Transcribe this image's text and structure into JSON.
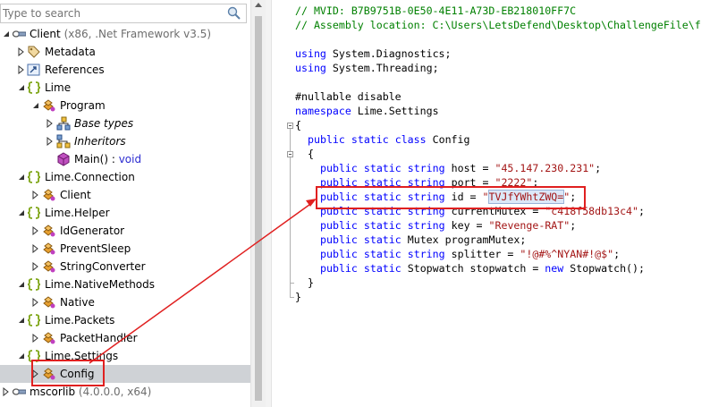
{
  "search": {
    "placeholder": "Type to search"
  },
  "tree": {
    "client": {
      "name": "Client",
      "details": " (x86, .Net Framework v3.5)"
    },
    "metadata": "Metadata",
    "references": "References",
    "lime": "Lime",
    "program": "Program",
    "base_types": "Base types",
    "inheritors": "Inheritors",
    "main_method": {
      "name": "Main()",
      "sep": " : ",
      "type": "void"
    },
    "lime_connection": "Lime.Connection",
    "client_class": "Client",
    "lime_helper": "Lime.Helper",
    "id_generator": "IdGenerator",
    "prevent_sleep": "PreventSleep",
    "string_converter": "StringConverter",
    "lime_native": "Lime.NativeMethods",
    "native": "Native",
    "lime_packets": "Lime.Packets",
    "packet_handler": "PacketHandler",
    "lime_settings": "Lime.Settings",
    "config": "Config",
    "mscorlib": {
      "name": "mscorlib",
      "details": " (4.0.0.0, x64)"
    }
  },
  "code": {
    "mvid": "// MVID: B7B9751B-0E50-4E11-A73D-EB218010FF7C",
    "location": "// Assembly location: C:\\Users\\LetsDefend\\Desktop\\ChallengeFile\\f",
    "kw_using": "using",
    "using_diag": " System.Diagnostics;",
    "using_thread": " System.Threading;",
    "nullable": "#nullable disable",
    "kw_namespace": "namespace",
    "namespace_name": " Lime.Settings",
    "open_brace": "{",
    "close_brace": "}",
    "kw_public_static_class": "public static class",
    "class_name": " Config",
    "kw_public_static": "public static",
    "kw_string": "string",
    "kw_new": "new",
    "host_mid": " host = ",
    "host_val": "\"45.147.230.231\"",
    "port_mid": " port = ",
    "port_val": "\"2222\"",
    "id_mid": " id = ",
    "id_q": "\"",
    "id_val": "TVJfYWhtZWQ=",
    "mutex_mid": " currentMutex = ",
    "mutex_val": "\"c418f58db13c4\"",
    "key_mid": " key = ",
    "key_val": "\"Revenge-RAT\"",
    "prog_mutex": " Mutex programMutex;",
    "split_mid": " splitter = ",
    "split_val": "\"!@#%^NYAN#!@$\"",
    "sw_mid": " Stopwatch stopwatch = ",
    "sw_end": " Stopwatch();",
    "semi": ";"
  },
  "colors": {
    "keyword": "#0000ff",
    "comment": "#008000",
    "string": "#a31515",
    "annotation": "#e02020",
    "selection": "#cfd2d6"
  }
}
